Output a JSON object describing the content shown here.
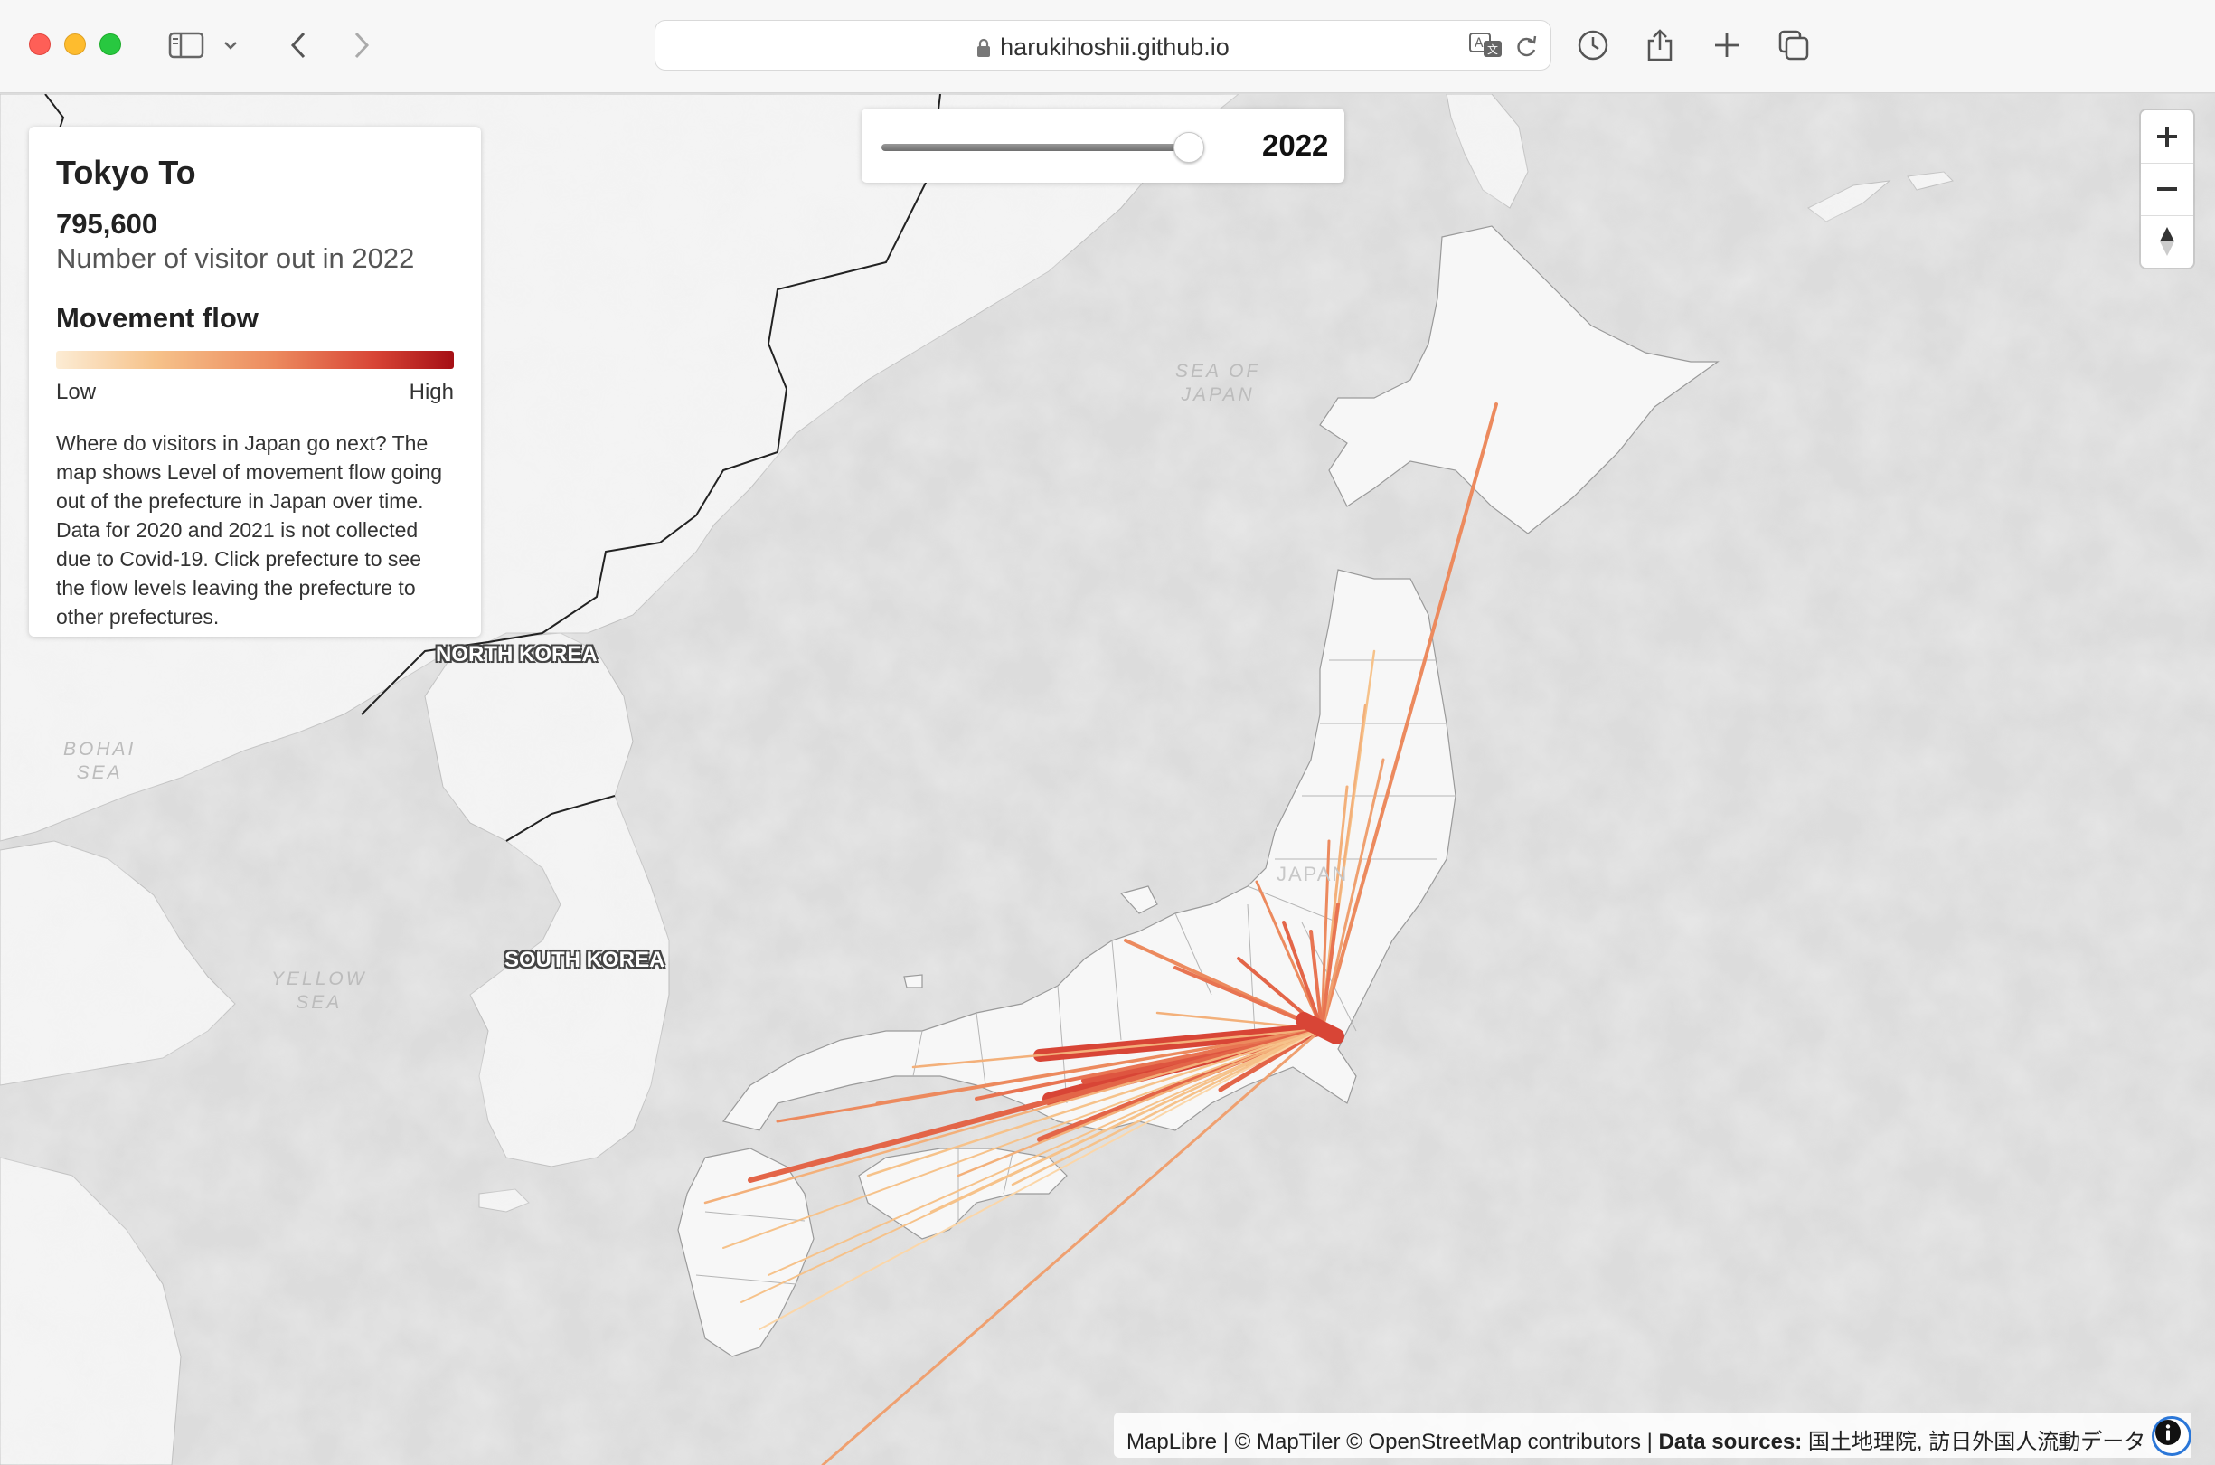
{
  "browser": {
    "url": "harukihoshii.github.io",
    "icons": [
      "sidebar-icon",
      "chevron-down-icon",
      "back-icon",
      "forward-icon",
      "lock-icon",
      "translate-icon",
      "reload-icon",
      "history-icon",
      "share-icon",
      "new-tab-icon",
      "tabs-overview-icon"
    ]
  },
  "panel": {
    "title": "Tokyo To",
    "value": "795,600",
    "subtitle": "Number of visitor out in 2022",
    "legend_title": "Movement flow",
    "legend_low": "Low",
    "legend_high": "High",
    "description": "Where do visitors in Japan go next? The map shows Level of movement flow going out of the prefecture in Japan over time. Data for 2020 and 2021 is not collected due to Covid-19. Click prefecture to see the flow levels leaving the prefecture to other prefectures."
  },
  "slider": {
    "year": "2022",
    "value_fraction": 1.0
  },
  "map_labels": {
    "north_korea": "NORTH KOREA",
    "south_korea": "SOUTH KOREA",
    "japan": "JAPAN",
    "sea_of_japan_1": "SEA OF",
    "sea_of_japan_2": "JAPAN",
    "bohai_1": "BOHAI",
    "bohai_2": "SEA",
    "yellow_1": "YELLOW",
    "yellow_2": "SEA"
  },
  "zoom": {
    "zoom_in": "+",
    "zoom_out": "−",
    "compass_icon": "compass-icon"
  },
  "attribution": {
    "maplibre": "MapLibre",
    "sep1": " | © MapTiler © OpenStreetMap contributors | ",
    "sources_label": "Data sources:",
    "sources": " 国土地理院, 訪日外国人流動データ"
  },
  "colors": {
    "legend_low": "#fcecd4",
    "legend_high": "#a50f15",
    "water": "#dcdcdc",
    "land": "#f4f4f4"
  }
}
